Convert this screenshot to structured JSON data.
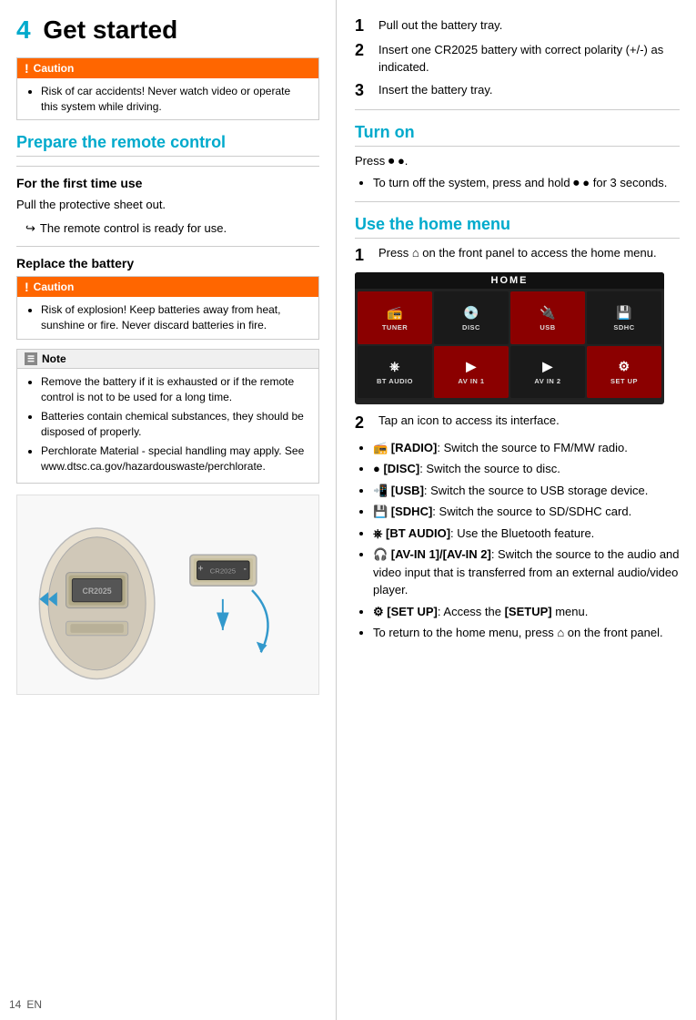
{
  "page": {
    "number": "14",
    "language": "EN"
  },
  "chapter": {
    "number": "4",
    "title": "Get started"
  },
  "left": {
    "caution_top": {
      "header": "Caution",
      "items": [
        "Risk of car accidents! Never watch video or operate this system while driving."
      ]
    },
    "prepare_section": {
      "title": "Prepare the remote control"
    },
    "first_time_section": {
      "title": "For the first time use",
      "body": "Pull the protective sheet out.",
      "arrow": "The remote control is ready for use."
    },
    "replace_battery_section": {
      "title": "Replace the battery"
    },
    "caution_battery": {
      "header": "Caution",
      "items": [
        "Risk of explosion! Keep batteries away from heat, sunshine or fire. Never discard batteries in fire."
      ]
    },
    "note_battery": {
      "header": "Note",
      "items": [
        "Remove the battery if it is exhausted or if the remote control is not to be used for a long time.",
        "Batteries contain chemical substances, they should be disposed of properly.",
        "Perchlorate Material - special handling may apply. See www.dtsc.ca.gov/hazardouswaste/perchlorate."
      ]
    }
  },
  "right": {
    "battery_steps": {
      "steps": [
        {
          "num": "1",
          "text": "Pull out the battery tray."
        },
        {
          "num": "2",
          "text": "Insert one CR2025 battery with correct polarity (+/-) as indicated."
        },
        {
          "num": "3",
          "text": "Insert the battery tray."
        }
      ]
    },
    "turn_on_section": {
      "title": "Turn on",
      "press_text": "Press Ⓤ •.",
      "bullet": "To turn off the system, press and hold Ⓤ • for 3 seconds."
    },
    "home_menu_section": {
      "title": "Use the home menu",
      "step1": {
        "num": "1",
        "text": "Press ⌂ on the front panel to access the home menu."
      },
      "menu_header": "HOME",
      "menu_items": [
        {
          "icon": "📻",
          "label": "TUNER"
        },
        {
          "icon": "💿",
          "label": "DISC"
        },
        {
          "icon": "📲",
          "label": "USB"
        },
        {
          "icon": "📱",
          "label": "SDHC"
        },
        {
          "icon": "BT",
          "label": "BT AUDIO"
        },
        {
          "icon": "▷◁",
          "label": "AV IN 1"
        },
        {
          "icon": "▷◁",
          "label": "AV IN 2"
        },
        {
          "icon": "⚙",
          "label": "SET UP"
        }
      ],
      "step2": {
        "num": "2",
        "text": "Tap an icon to access its interface."
      },
      "bullets": [
        {
          "label": "[RADIO]",
          "text": ": Switch the source to FM/MW radio."
        },
        {
          "label": "[DISC]",
          "text": ": Switch the source to disc."
        },
        {
          "label": "[USB]",
          "text": ": Switch the source to USB storage device."
        },
        {
          "label": "[SDHC]",
          "text": ": Switch the source to SD/SDHC card."
        },
        {
          "label": "[BT AUDIO]",
          "text": ": Use the Bluetooth feature."
        },
        {
          "label": "[AV-IN 1]/[AV-IN 2]",
          "text": ": Switch the source to the audio and video input that is transferred from an external audio/video player."
        },
        {
          "label": "[SET UP]",
          "text": ": Access the [SETUP] menu."
        },
        {
          "label": "",
          "text": "To return to the home menu, press ⌂ on the front panel."
        }
      ]
    }
  }
}
